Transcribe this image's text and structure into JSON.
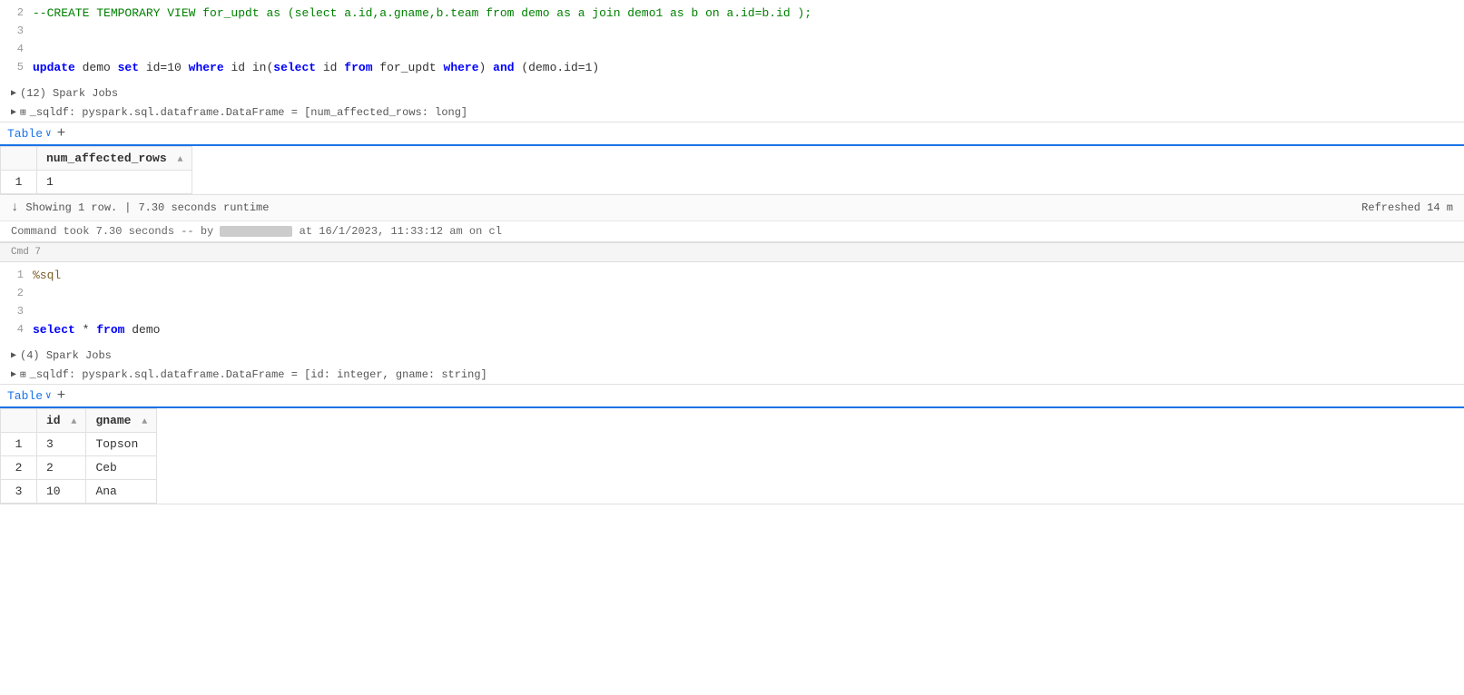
{
  "cells": [
    {
      "id": "cmd6",
      "cmd_label": "",
      "show_cmd_label": false,
      "code_lines": [
        {
          "num": 2,
          "text": "--CREATE TEMPORARY VIEW for_updt as (select a.id,a.gname,b.team from demo as a join demo1 as b on a.id=b.id );"
        },
        {
          "num": 3,
          "text": ""
        },
        {
          "num": 4,
          "text": ""
        },
        {
          "num": 5,
          "text": "update demo set id=10 where id in(select id from for_updt where) and (demo.id=1)"
        }
      ],
      "spark_jobs": "(12) Spark Jobs",
      "sqldf_label": "_sqldf: pyspark.sql.dataframe.DataFrame = [num_affected_rows: long]",
      "table_tab_label": "Table",
      "table_plus_label": "+",
      "table_columns": [
        {
          "key": "num_affected_rows",
          "label": "num_affected_rows"
        }
      ],
      "table_rows": [
        {
          "row_num": 1,
          "num_affected_rows": "1"
        }
      ],
      "footer_showing": "Showing 1 row.",
      "footer_runtime": "7.30 seconds runtime",
      "footer_refreshed": "Refreshed 14 m",
      "cmd_took": "Command took 7.30 seconds -- by",
      "cmd_took_suffix": "at 16/1/2023, 11:33:12 am on cl"
    },
    {
      "id": "cmd7",
      "cmd_label": "Cmd 7",
      "show_cmd_label": true,
      "code_lines": [
        {
          "num": 1,
          "text": "%sql"
        },
        {
          "num": 2,
          "text": ""
        },
        {
          "num": 3,
          "text": ""
        },
        {
          "num": 4,
          "text": "select * from demo"
        }
      ],
      "spark_jobs": "(4) Spark Jobs",
      "sqldf_label": "_sqldf: pyspark.sql.dataframe.DataFrame = [id: integer, gname: string]",
      "table_tab_label": "Table",
      "table_plus_label": "+",
      "table_columns": [
        {
          "key": "id",
          "label": "id"
        },
        {
          "key": "gname",
          "label": "gname"
        }
      ],
      "table_rows": [
        {
          "row_num": 1,
          "id": "3",
          "gname": "Topson"
        },
        {
          "row_num": 2,
          "id": "2",
          "gname": "Ceb"
        },
        {
          "row_num": 3,
          "id": "10",
          "gname": "Ana"
        }
      ],
      "footer_showing": "",
      "footer_runtime": "",
      "footer_refreshed": "",
      "cmd_took": "",
      "cmd_took_suffix": ""
    }
  ],
  "ui": {
    "sort_icon": "▲",
    "triangle_right": "▶",
    "chevron_down": "∨",
    "download_icon": "↓",
    "table_icon": "⊞"
  }
}
